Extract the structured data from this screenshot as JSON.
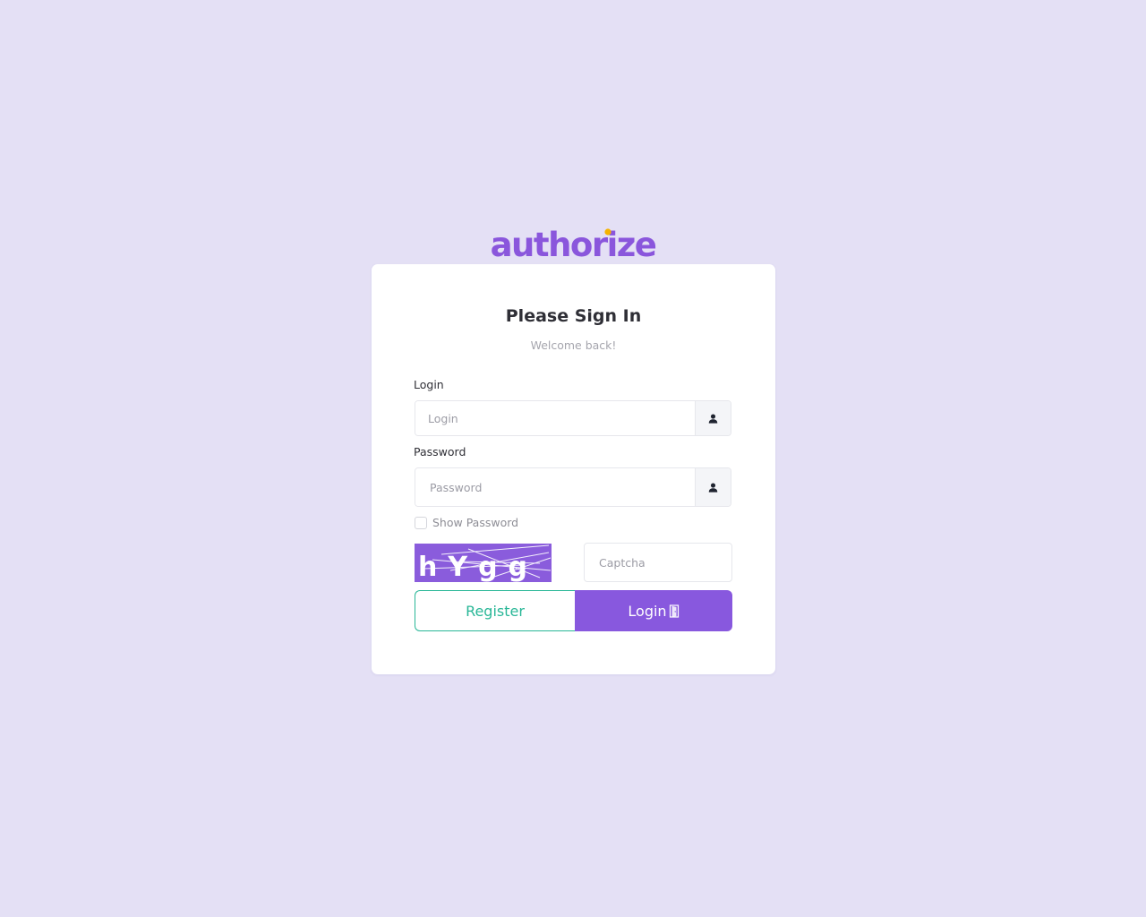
{
  "brand": {
    "name": "authorize",
    "color": "#8a56dc",
    "dot_color": "#f5b301"
  },
  "form": {
    "title": "Please Sign In",
    "subtitle": "Welcome back!",
    "login_label": "Login",
    "login_placeholder": "Login",
    "login_value": "",
    "login_icon": "user-icon",
    "password_label": "Password",
    "password_placeholder": "Password",
    "password_value": "",
    "password_icon": "user-icon",
    "show_password_label": "Show Password",
    "show_password_checked": false,
    "captcha_text": "hYgg",
    "captcha_placeholder": "Captcha",
    "captcha_value": "",
    "register_label": "Register",
    "login_button_label": "Login",
    "login_button_icon": "door-icon"
  },
  "colors": {
    "background": "#e4e0f5",
    "accent": "#8858de",
    "register": "#29b797"
  }
}
